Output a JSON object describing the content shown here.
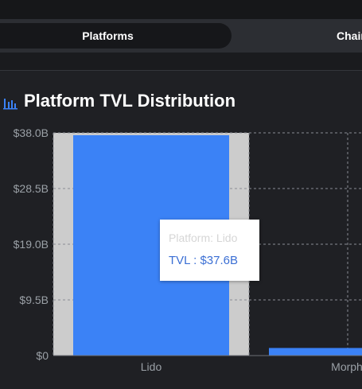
{
  "tabs": {
    "platforms": "Platforms",
    "chains": "Chains"
  },
  "chart_title": "Platform TVL Distribution",
  "tooltip": {
    "platform_line": "Platform: Lido",
    "tvl_line": "TVL : $37.6B"
  },
  "colors": {
    "bar": "#3b82f6",
    "hover_band": "#cccccc",
    "axis_text": "#9aa0a6",
    "grid": "#8a8d93",
    "background": "#1f2024"
  },
  "chart_data": {
    "type": "bar",
    "title": "Platform TVL Distribution",
    "categories": [
      "Lido",
      "Morph"
    ],
    "values": [
      37.6,
      1.3
    ],
    "ylim": [
      0,
      38
    ],
    "yticks": [
      0,
      9.5,
      19,
      28.5,
      38
    ],
    "ytick_labels": [
      "$0",
      "$9.5B",
      "$19.0B",
      "$28.5B",
      "$38.0B"
    ],
    "grid": true,
    "highlighted_category": "Lido",
    "unit": "B USD"
  }
}
